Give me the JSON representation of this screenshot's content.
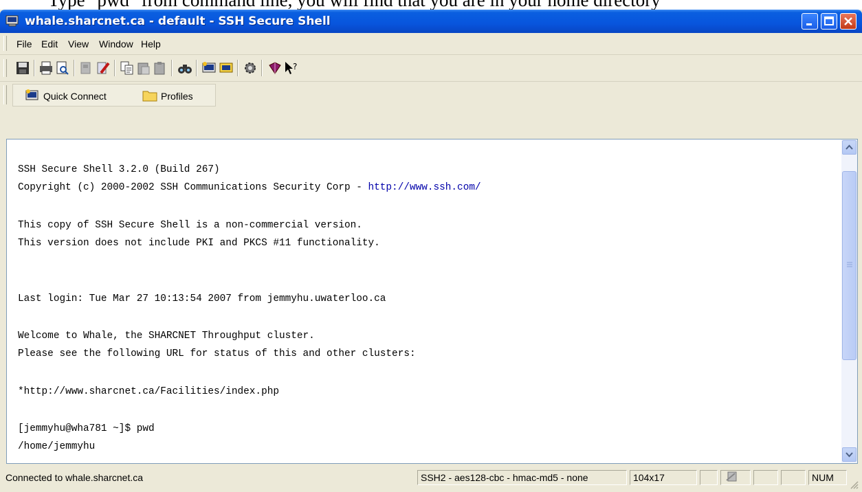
{
  "document": {
    "heading": "Type \"pwd\" from command line, you will find that you are in your home directory"
  },
  "window": {
    "title": "whale.sharcnet.ca - default - SSH Secure Shell"
  },
  "menu": {
    "items": [
      "File",
      "Edit",
      "View",
      "Window",
      "Help"
    ]
  },
  "quickbar": {
    "quick_connect": "Quick Connect",
    "profiles": "Profiles"
  },
  "terminal": {
    "lines": [
      "SSH Secure Shell 3.2.0 (Build 267)",
      "Copyright (c) 2000-2002 SSH Communications Security Corp - ",
      "This copy of SSH Secure Shell is a non-commercial version.",
      "This version does not include PKI and PKCS #11 functionality.",
      "Last login: Tue Mar 27 10:13:54 2007 from jemmyhu.uwaterloo.ca",
      "Welcome to Whale, the SHARCNET Throughput cluster.",
      "Please see the following URL for status of this and other clusters:",
      "*http://www.sharcnet.ca/Facilities/index.php",
      "[jemmyhu@wha781 ~]$ pwd",
      "/home/jemmyhu"
    ],
    "copyright_url": "http://www.ssh.com/"
  },
  "status": {
    "connection": "Connected to whale.sharcnet.ca",
    "cipher": "SSH2 - aes128-cbc - hmac-md5 - none",
    "size": "104x17",
    "num": "NUM"
  },
  "icons": [
    "save-icon",
    "print-icon",
    "print-preview-icon",
    "disconnect-icon",
    "settings-icon",
    "copy-icon",
    "paste-icon",
    "paste-alt-icon",
    "find-icon",
    "new-terminal-icon",
    "new-file-transfer-icon",
    "gear-icon",
    "help-book-icon",
    "context-help-icon"
  ]
}
